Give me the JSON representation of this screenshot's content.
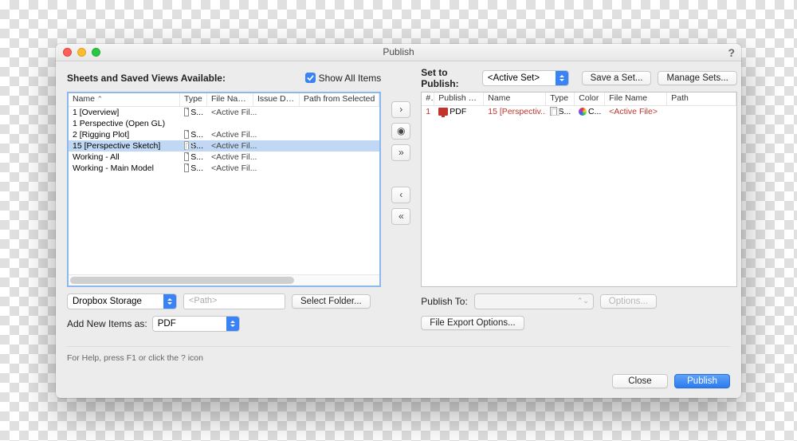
{
  "window": {
    "title": "Publish",
    "help": "?"
  },
  "left": {
    "heading": "Sheets and Saved Views Available:",
    "show_all_label": "Show All Items",
    "headers": {
      "name": "Name",
      "type": "Type",
      "file": "File Name",
      "issue": "Issue Date",
      "path": "Path from Selected"
    },
    "rows": [
      {
        "name": "1 [Overview]",
        "type": "S...",
        "file": "<Active Fil..."
      },
      {
        "name": "1 Perspective (Open GL)"
      },
      {
        "name": "2 [Rigging Plot]",
        "type": "S...",
        "file": "<Active Fil..."
      },
      {
        "name": "15 [Perspective Sketch]",
        "type": "S...",
        "file": "<Active Fil...",
        "selected": true
      },
      {
        "name": "Working - All",
        "type": "S...",
        "file": "<Active Fil..."
      },
      {
        "name": "Working - Main Model",
        "type": "S...",
        "file": "<Active Fil..."
      }
    ],
    "storage_select": "Dropbox Storage",
    "path_placeholder": "<Path>",
    "select_folder": "Select Folder...",
    "add_new_label": "Add New Items as:",
    "add_new_value": "PDF"
  },
  "center": {
    "right1": "›",
    "eye": "◉",
    "right2": "»",
    "left1": "‹",
    "left2": "«"
  },
  "right": {
    "set_label": "Set to Publish:",
    "set_value": "<Active Set>",
    "save_set": "Save a Set...",
    "manage_sets": "Manage Sets...",
    "headers": {
      "num": "#",
      "publish_to": "Publish To",
      "name": "Name",
      "type": "Type",
      "color": "Color",
      "file": "File Name",
      "path": "Path"
    },
    "rows": [
      {
        "num": "1",
        "publish_to": "PDF",
        "name": "15 [Perspectiv...",
        "type": "S...",
        "color": "C...",
        "file": "<Active File>"
      }
    ],
    "publish_to_label": "Publish To:",
    "options": "Options...",
    "file_export": "File Export Options..."
  },
  "hint": "For Help, press F1 or click the ? icon",
  "footer": {
    "close": "Close",
    "publish": "Publish"
  }
}
